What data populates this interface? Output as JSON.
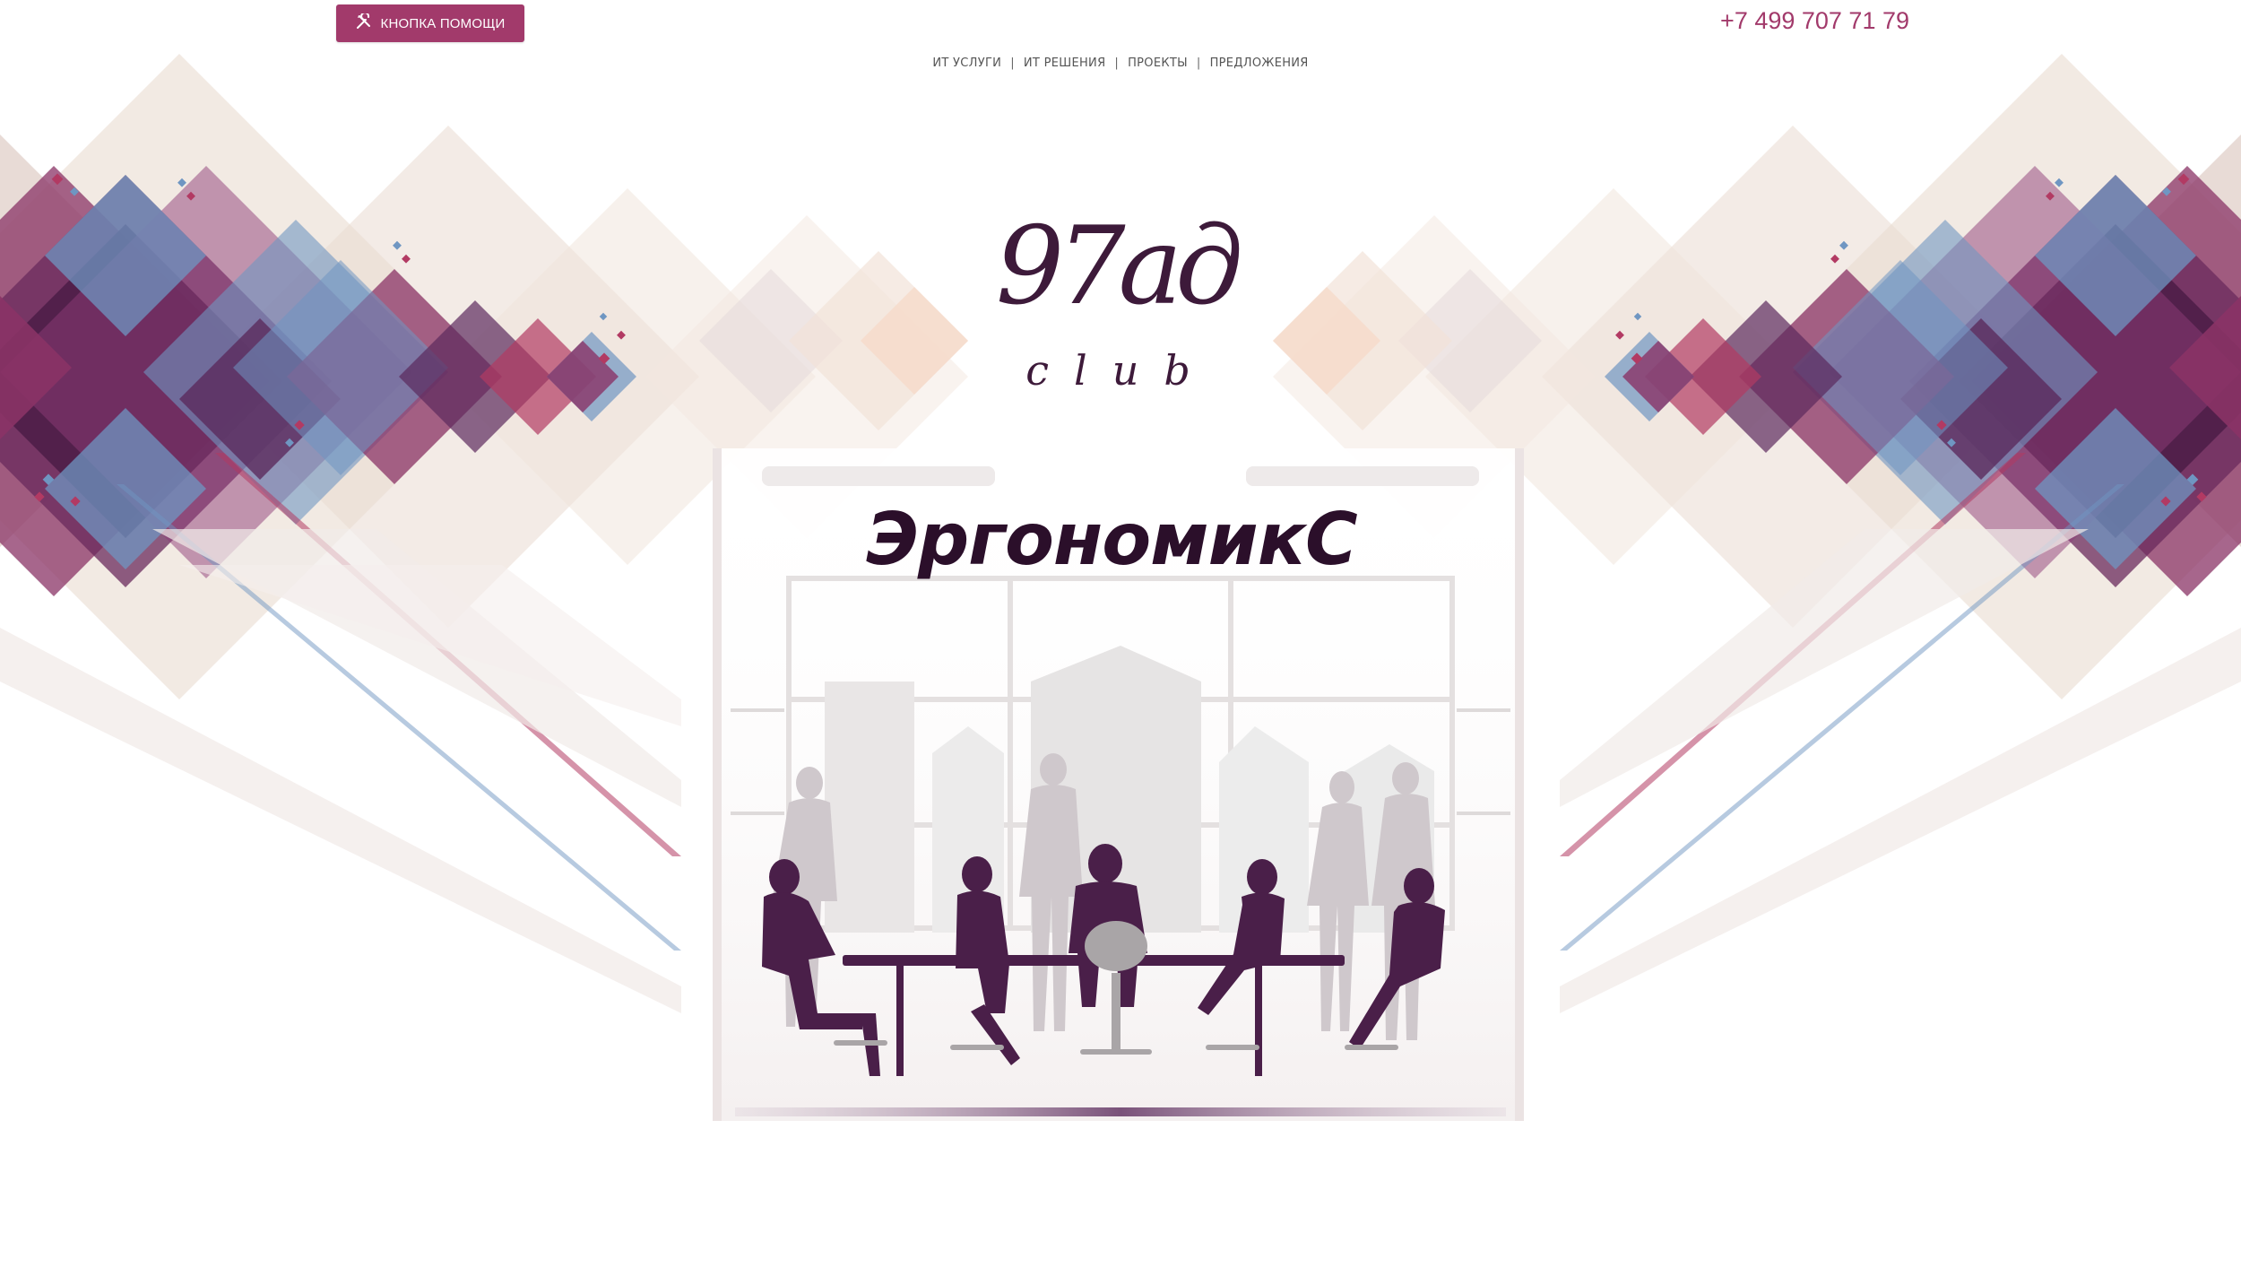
{
  "header": {
    "help_button_label": "КНОПКА ПОМОЩИ",
    "help_icon": "tools-icon",
    "phone": "+7 499 707 71 79"
  },
  "nav": {
    "items": [
      "ИТ УСЛУГИ",
      "ИТ РЕШЕНИЯ",
      "ПРОЕКТЫ",
      "ПРЕДЛОЖЕНИЯ"
    ],
    "separator": "|"
  },
  "logo": {
    "main_text": "97ад",
    "sub_text": "club"
  },
  "hero": {
    "headline": "ЭргономикС"
  },
  "colors": {
    "accent": "#a23a6b",
    "plum": "#5b2a5c",
    "dark_plum": "#3d1a3a",
    "blue": "#6f96c2",
    "beige": "#e8d8cc",
    "magenta": "#b23a63"
  }
}
